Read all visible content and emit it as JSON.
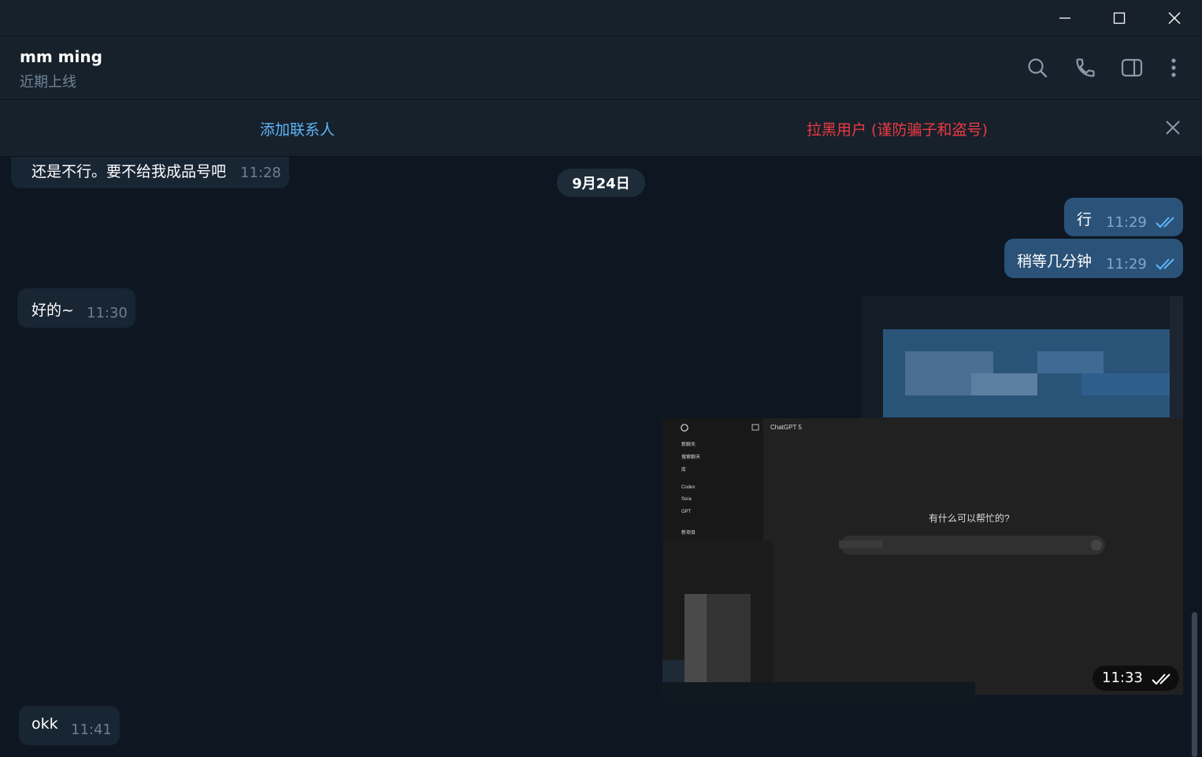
{
  "window": {
    "minimize_icon": "minimize-icon",
    "maximize_icon": "maximize-icon",
    "close_icon": "close-icon"
  },
  "header": {
    "name": "mm ming",
    "status": "近期上线",
    "icons": [
      "search-icon",
      "phone-icon",
      "sidebar-toggle-icon",
      "more-vertical-icon"
    ]
  },
  "banner": {
    "add_contact": "添加联系人",
    "block_user": "拉黑用户 (谨防骗子和盗号)"
  },
  "chat": {
    "date_separator": "9月24日",
    "messages": [
      {
        "direction": "in",
        "text": "还是不行。要不给我成品号吧",
        "time": "11:28"
      },
      {
        "direction": "out",
        "text": "行",
        "time": "11:29",
        "read": true
      },
      {
        "direction": "out",
        "text": "稍等几分钟",
        "time": "11:29",
        "read": true
      },
      {
        "direction": "in",
        "text": "好的~",
        "time": "11:30"
      },
      {
        "direction": "out",
        "type": "image",
        "time": "11:33",
        "read": true,
        "image_text": {
          "app_title": "ChatGPT 5",
          "sidebar": [
            "新聊天",
            "搜索聊天",
            "库",
            "Codex",
            "Sora",
            "GPT",
            "新项目"
          ],
          "prompt": "有什么可以帮忙的?"
        }
      },
      {
        "direction": "in",
        "text": "okk",
        "time": "11:41"
      }
    ]
  },
  "colors": {
    "background": "#0e1621",
    "header": "#17212b",
    "incoming": "#182533",
    "outgoing": "#2b5278",
    "link": "#5eb5f7",
    "danger": "#ec3942"
  }
}
